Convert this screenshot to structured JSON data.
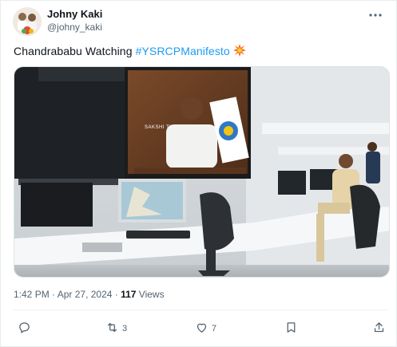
{
  "author": {
    "display_name": "Johny Kaki",
    "handle": "@johny_kaki"
  },
  "post": {
    "text_plain": "Chandrababu Watching ",
    "hashtag": "#YSRCPManifesto",
    "emoji_icon": "collision-sparkle-icon"
  },
  "media": {
    "type": "photo",
    "screen_label": "SAKSHI TV"
  },
  "meta": {
    "time": "1:42 PM",
    "separator1": " · ",
    "date": "Apr 27, 2024",
    "separator2": " · ",
    "views_count": "117",
    "views_label": " Views"
  },
  "actions": {
    "reply_count": "",
    "repost_count": "3",
    "like_count": "7",
    "bookmark_count": ""
  },
  "colors": {
    "accent": "#1d9bf0",
    "secondary_text": "#536471",
    "primary_text": "#0f1419"
  }
}
